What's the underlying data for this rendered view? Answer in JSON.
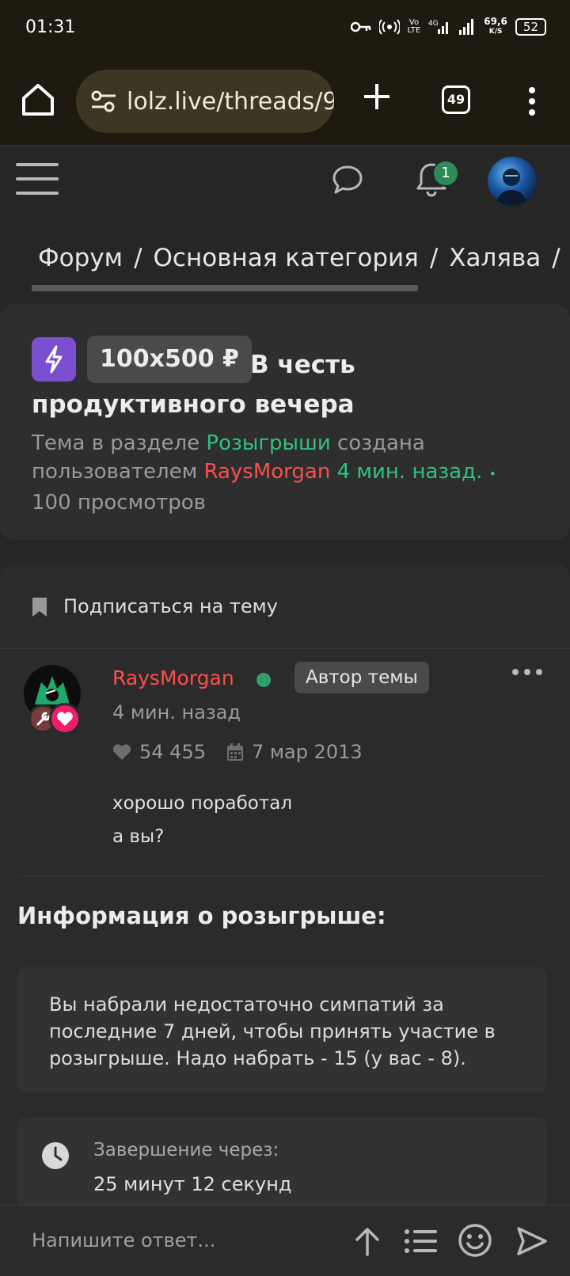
{
  "status_bar": {
    "time": "01:31",
    "net_speed": "69,6",
    "net_speed_unit": "K/S",
    "battery": "52"
  },
  "browser": {
    "url": "lolz.live/threads/9",
    "tab_count": "49"
  },
  "header": {
    "notifications_count": "1"
  },
  "breadcrumb": {
    "items": [
      "Форум",
      "Основная категория",
      "Халява"
    ],
    "separator": "/"
  },
  "thread": {
    "prefix": "100x500 ₽",
    "title": "В честь продуктивного вечера",
    "meta_prefix": "Тема в разделе",
    "section": "Розыгрыши",
    "meta_created_by": "создана пользователем",
    "author": "RaysMorgan",
    "time_ago": "4 мин. назад.",
    "dot": "•",
    "views": "100 просмотров"
  },
  "post": {
    "subscribe_label": "Подписаться на тему",
    "username": "RaysMorgan",
    "author_badge": "Автор темы",
    "time": "4 мин. назад",
    "likes": "54 455",
    "reg_date": "7 мар 2013",
    "body_line1": "хорошо поработал",
    "body_line2": "а вы?",
    "giveaway_heading": "Информация о розыгрыше:",
    "notice": "Вы набрали недостаточно симпатий за последние 7 дней, чтобы принять участие в розыгрыше. Надо набрать - 15 (у вас - 8).",
    "timer_label": "Завершение через:",
    "timer_value": "25 минут 12 секунд"
  },
  "reply": {
    "placeholder": "Напишите ответ..."
  },
  "colors": {
    "accent_green": "#2ec27e",
    "username_red": "#ff4d4d",
    "bolt_purple": "#7b4fd0",
    "heart_pink": "#ef1d6e"
  }
}
